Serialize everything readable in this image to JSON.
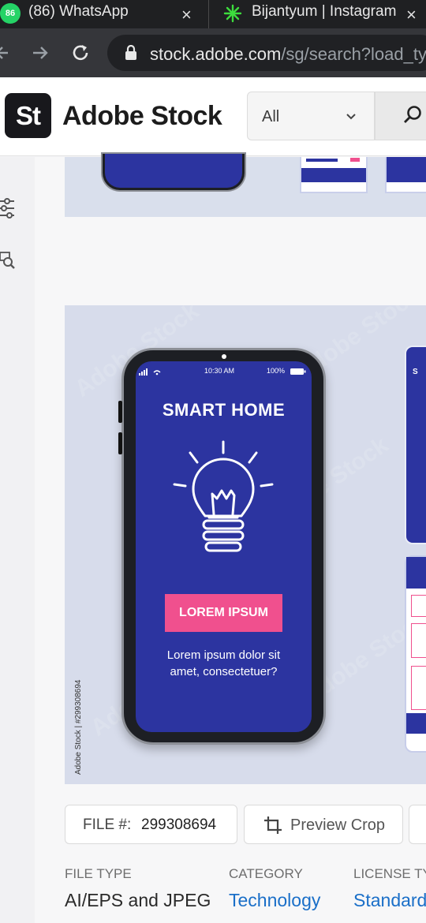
{
  "browser": {
    "tabs": [
      {
        "badge": "86",
        "title": "(86) WhatsApp",
        "close": "×"
      },
      {
        "title": "Bijantyum | Instagram",
        "close": "×"
      }
    ],
    "url_host": "stock.adobe.com",
    "url_path": "/sg/search?load_typ"
  },
  "header": {
    "logo_text": "St",
    "brand": "Adobe Stock",
    "filter_value": "All"
  },
  "preview": {
    "status_time": "10:30 AM",
    "status_battery": "100%",
    "app_title": "SMART HOME",
    "button_label": "LOREM IPSUM",
    "body_line1": "Lorem ipsum dolor sit",
    "body_line2": "amet, consectetuer?",
    "watermark": "Adobe Stock",
    "credit": "Adobe Stock | #299308694"
  },
  "file_info": {
    "file_label": "FILE #:",
    "file_number": "299308694",
    "preview_crop": "Preview Crop"
  },
  "meta": {
    "file_type_label": "FILE TYPE",
    "file_type_value": "AI/EPS and JPEG",
    "category_label": "CATEGORY",
    "category_value": "Technology",
    "license_label": "LICENSE TY",
    "license_value": "Standard"
  },
  "colors": {
    "brand_dark": "#18181c",
    "screen_blue": "#2c34a0",
    "cta_pink": "#f0508e",
    "link_blue": "#1a6fc8"
  }
}
